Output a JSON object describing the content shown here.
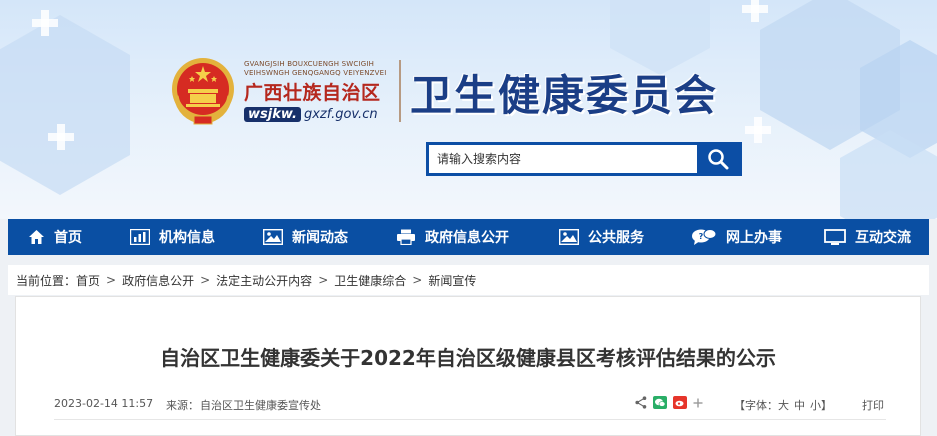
{
  "header": {
    "zhuang_line1": "GVANGJSIH BOUXCUENGH SWCIGIH",
    "zhuang_line2": "VEIHSWNGH GENQGANGQ VEIYENZVEI",
    "region_name": "广西壮族自治区",
    "domain_prefix": "wsjkw.",
    "domain_suffix": "gxzf.gov.cn",
    "org_title": "卫生健康委员会",
    "emblem_icon": "national-emblem-icon"
  },
  "search": {
    "placeholder": "请输入搜索内容",
    "button_icon": "search-icon"
  },
  "nav": {
    "items": [
      {
        "label": "首页",
        "icon": "home-icon"
      },
      {
        "label": "机构信息",
        "icon": "bar-chart-icon"
      },
      {
        "label": "新闻动态",
        "icon": "image-icon"
      },
      {
        "label": "政府信息公开",
        "icon": "printer-icon"
      },
      {
        "label": "公共服务",
        "icon": "image-icon"
      },
      {
        "label": "网上办事",
        "icon": "chat-bubble-icon"
      },
      {
        "label": "互动交流",
        "icon": "monitor-icon"
      }
    ]
  },
  "breadcrumb": {
    "prefix": "当前位置：",
    "items": [
      "首页",
      "政府信息公开",
      "法定主动公开内容",
      "卫生健康综合",
      "新闻宣传"
    ],
    "separator": ">"
  },
  "article": {
    "title": "自治区卫生健康委关于2022年自治区级健康县区考核评估结果的公示",
    "date": "2023-02-14 11:57",
    "source_label": "来源：",
    "source": "自治区卫生健康委宣传处",
    "font_label": "【字体：",
    "font_large": "大",
    "font_medium": "中",
    "font_small": "小",
    "font_close": "】",
    "print": "打印"
  },
  "colors": {
    "nav_bg": "#0a4fa3",
    "title_blue": "#1b3e86",
    "region_red": "#b5281e",
    "search_blue": "#0c4ea5"
  }
}
